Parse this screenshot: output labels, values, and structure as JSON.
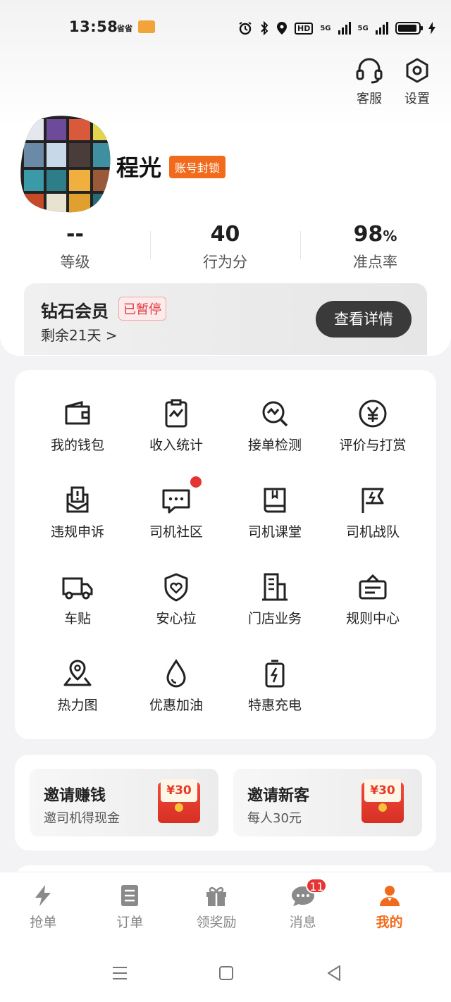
{
  "status_bar": {
    "time": "13:58",
    "carrier_tag": "省省",
    "hd": "HD",
    "net1": "5G",
    "net2": "5G"
  },
  "header": {
    "service_label": "客服",
    "settings_label": "设置"
  },
  "profile": {
    "name": "程光",
    "lock_badge": "账号封锁"
  },
  "stats": [
    {
      "value": "--",
      "label": "等级"
    },
    {
      "value": "40",
      "label": "行为分"
    },
    {
      "value": "98",
      "unit": "%",
      "label": "准点率"
    }
  ],
  "membership": {
    "title": "钻石会员",
    "status": "已暂停",
    "remaining": "剩余21天 >",
    "detail_button": "查看详情"
  },
  "grid": [
    {
      "label": "我的钱包",
      "icon": "wallet-icon"
    },
    {
      "label": "收入统计",
      "icon": "income-chart-icon"
    },
    {
      "label": "接单检测",
      "icon": "order-check-icon"
    },
    {
      "label": "评价与打赏",
      "icon": "yen-coin-icon"
    },
    {
      "label": "违规申诉",
      "icon": "appeal-icon"
    },
    {
      "label": "司机社区",
      "icon": "chat-bubble-icon"
    },
    {
      "label": "司机课堂",
      "icon": "book-icon"
    },
    {
      "label": "司机战队",
      "icon": "team-flag-icon"
    },
    {
      "label": "车贴",
      "icon": "truck-icon"
    },
    {
      "label": "安心拉",
      "icon": "shield-heart-icon"
    },
    {
      "label": "门店业务",
      "icon": "store-building-icon"
    },
    {
      "label": "规则中心",
      "icon": "rules-board-icon"
    },
    {
      "label": "热力图",
      "icon": "map-pin-icon"
    },
    {
      "label": "优惠加油",
      "icon": "fuel-drop-icon"
    },
    {
      "label": "特惠充电",
      "icon": "battery-charge-icon"
    }
  ],
  "invites": [
    {
      "title": "邀请赚钱",
      "subtitle": "邀司机得现金",
      "amount": "¥30"
    },
    {
      "title": "邀请新客",
      "subtitle": "每人30元",
      "amount": "¥30"
    }
  ],
  "tabs": [
    {
      "label": "抢单",
      "icon": "lightning-icon"
    },
    {
      "label": "订单",
      "icon": "document-icon"
    },
    {
      "label": "领奖励",
      "icon": "gift-icon"
    },
    {
      "label": "消息",
      "icon": "message-icon",
      "badge": "11"
    },
    {
      "label": "我的",
      "icon": "person-icon",
      "active": true
    }
  ],
  "colors": {
    "accent": "#f26a1b",
    "alert": "#e63333"
  }
}
